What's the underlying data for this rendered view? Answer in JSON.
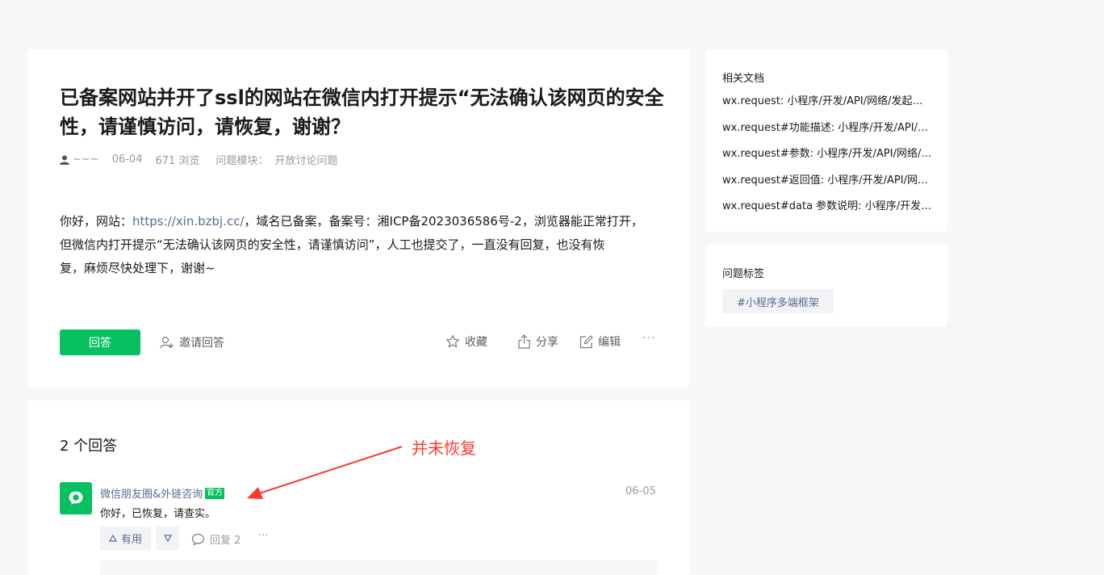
{
  "question": {
    "title": "已备案网站并开了ssl的网站在微信内打开提示“无法确认该网页的安全性，请谨慎访问，请恢复，谢谢？",
    "author": "~~~",
    "date": "06-04",
    "views": "671 浏览",
    "module_label": "问题模块：",
    "module_value": "开放讨论问题",
    "body_prefix": "你好，网站：",
    "body_link": "https://xin.bzbj.cc/",
    "body_line1_rest": "，域名已备案，备案号：湘ICP备2023036586号-2，浏览器能正常打开，",
    "body_line2": "但微信内打开提示“无法确认该网页的安全性，请谨慎访问”，人工也提交了，一直没有回复，也没有恢",
    "body_line3": "复，麻烦尽快处理下，谢谢~"
  },
  "actions": {
    "answer": "回答",
    "invite": "邀请回答",
    "favorite": "收藏",
    "share": "分享",
    "edit": "编辑",
    "more": "···"
  },
  "answers": {
    "count_label": "2 个回答",
    "items": [
      {
        "author": "微信朋友圈&外链咨询",
        "badge": "官方",
        "date": "06-05",
        "text": "你好，已恢复，请查实。",
        "useful_label": "有用",
        "reply_label": "回复 2",
        "more": "···"
      }
    ]
  },
  "annotation": {
    "text": "并未恢复",
    "color": "#fa3a2f"
  },
  "sidebar": {
    "docs_title": "相关文档",
    "docs": [
      "wx.request: 小程序/开发/API/网络/发起请求/wx.request",
      "wx.request#功能描述: 小程序/开发/API/网络/发起请求",
      "wx.request#参数: 小程序/开发/API/网络/发起请求",
      "wx.request#返回值: 小程序/开发/API/网络/发起请求",
      "wx.request#data 参数说明: 小程序/开发/API/网络"
    ],
    "tags_title": "问题标签",
    "tags": [
      "#小程序多端框架"
    ]
  },
  "colors": {
    "primary_green": "#07c160",
    "link_blue": "#576b95",
    "background": "#f7f7f7"
  }
}
